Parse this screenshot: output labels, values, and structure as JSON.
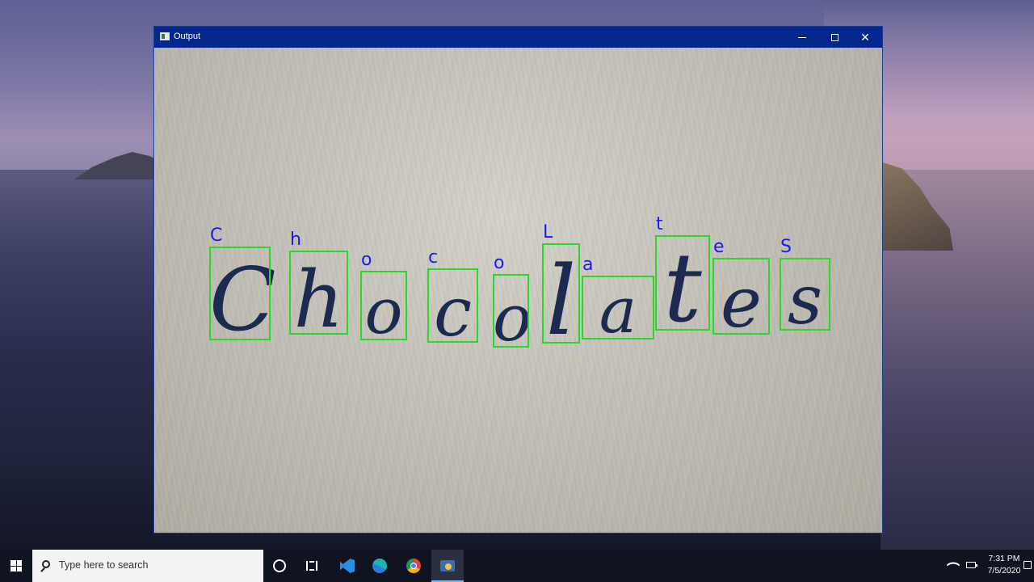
{
  "window": {
    "title": "Output",
    "icon": "window-app-icon",
    "controls": [
      "minimize-icon",
      "maximize-icon",
      "close-icon"
    ]
  },
  "handwritten_word": "Chocolates",
  "detections": [
    {
      "label": "C",
      "char": "C"
    },
    {
      "label": "h",
      "char": "h"
    },
    {
      "label": "o",
      "char": "o"
    },
    {
      "label": "c",
      "char": "c"
    },
    {
      "label": "o",
      "char": "o"
    },
    {
      "label": "L",
      "char": "l"
    },
    {
      "label": "a",
      "char": "a"
    },
    {
      "label": "t",
      "char": "t"
    },
    {
      "label": "e",
      "char": "e"
    },
    {
      "label": "S",
      "char": "s"
    }
  ],
  "colors": {
    "box": "#2cd62c",
    "label": "#1b1bf0",
    "titlebar": "#03278d",
    "ink": "#1c2a4f"
  },
  "taskbar": {
    "search_placeholder": "Type here to search",
    "apps": [
      "cortana-icon",
      "task-view-icon",
      "vscode-icon",
      "edge-icon",
      "chrome-icon",
      "python-app-icon"
    ],
    "time": "7:31 PM",
    "date": "7/5/2020"
  }
}
